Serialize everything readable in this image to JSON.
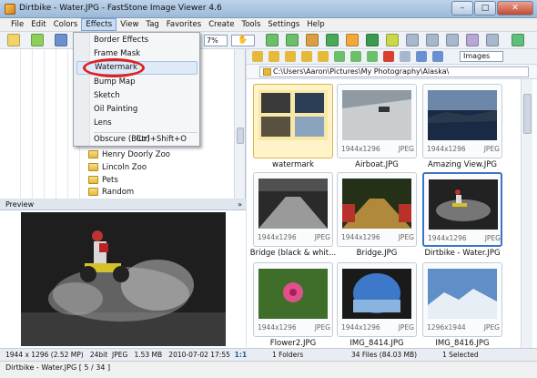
{
  "window": {
    "title": "Dirtbike - Water.JPG  -  FastStone Image Viewer 4.6",
    "min": "–",
    "max": "□",
    "close": "✕"
  },
  "menu": [
    "File",
    "Edit",
    "Colors",
    "Effects",
    "View",
    "Tag",
    "Favorites",
    "Create",
    "Tools",
    "Settings",
    "Help"
  ],
  "toolbar": {
    "zoom": "7%",
    "hand": "✋"
  },
  "effects_menu": {
    "items": [
      "Border Effects",
      "Frame Mask",
      "Watermark",
      "Bump Map",
      "Sketch",
      "Oil Painting",
      "Lens"
    ],
    "obscure": "Obscure (Blur)",
    "obscure_shortcut": "Ctrl+Shift+O",
    "highlighted": "Watermark"
  },
  "folder_tree": {
    "items": [
      "Henry Doorly Zoo",
      "Lincoln Zoo",
      "Pets",
      "Random"
    ]
  },
  "preview": {
    "header": "Preview",
    "close": "»"
  },
  "status_left": {
    "dims": "1944 x 1296 (2.52 MP)",
    "bits": "24bit",
    "format": "JPEG",
    "size": "1.53 MB",
    "date": "2010-07-02 17:55",
    "ratio": "1:1"
  },
  "nav": {
    "view_mode": "Images"
  },
  "address": "C:\\Users\\Aaron\\Pictures\\My Photography\\Alaska\\",
  "thumbnails": [
    {
      "name": "watermark",
      "dims": "",
      "format": "",
      "folder": true
    },
    {
      "name": "Airboat.JPG",
      "dims": "1944x1296",
      "format": "JPEG"
    },
    {
      "name": "Amazing View.JPG",
      "dims": "1944x1296",
      "format": "JPEG"
    },
    {
      "name": "Bridge (black & whit...",
      "dims": "1944x1296",
      "format": "JPEG"
    },
    {
      "name": "Bridge.JPG",
      "dims": "1944x1296",
      "format": "JPEG"
    },
    {
      "name": "Dirtbike - Water.JPG",
      "dims": "1944x1296",
      "format": "JPEG",
      "selected": true
    },
    {
      "name": "Flower2.JPG",
      "dims": "1944x1296",
      "format": "JPEG"
    },
    {
      "name": "IMG_8414.JPG",
      "dims": "1944x1296",
      "format": "JPEG"
    },
    {
      "name": "IMG_8416.JPG",
      "dims": "1296x1944",
      "format": "JPEG"
    }
  ],
  "status_right": {
    "folders": "1 Folders",
    "files": "34 Files (84.03 MB)",
    "selected": "1 Selected"
  },
  "bottom_status": "Dirtbike - Water.JPG [ 5 / 34 ]",
  "colors": {
    "selection": "#3d74c5",
    "circle": "#e02020"
  }
}
